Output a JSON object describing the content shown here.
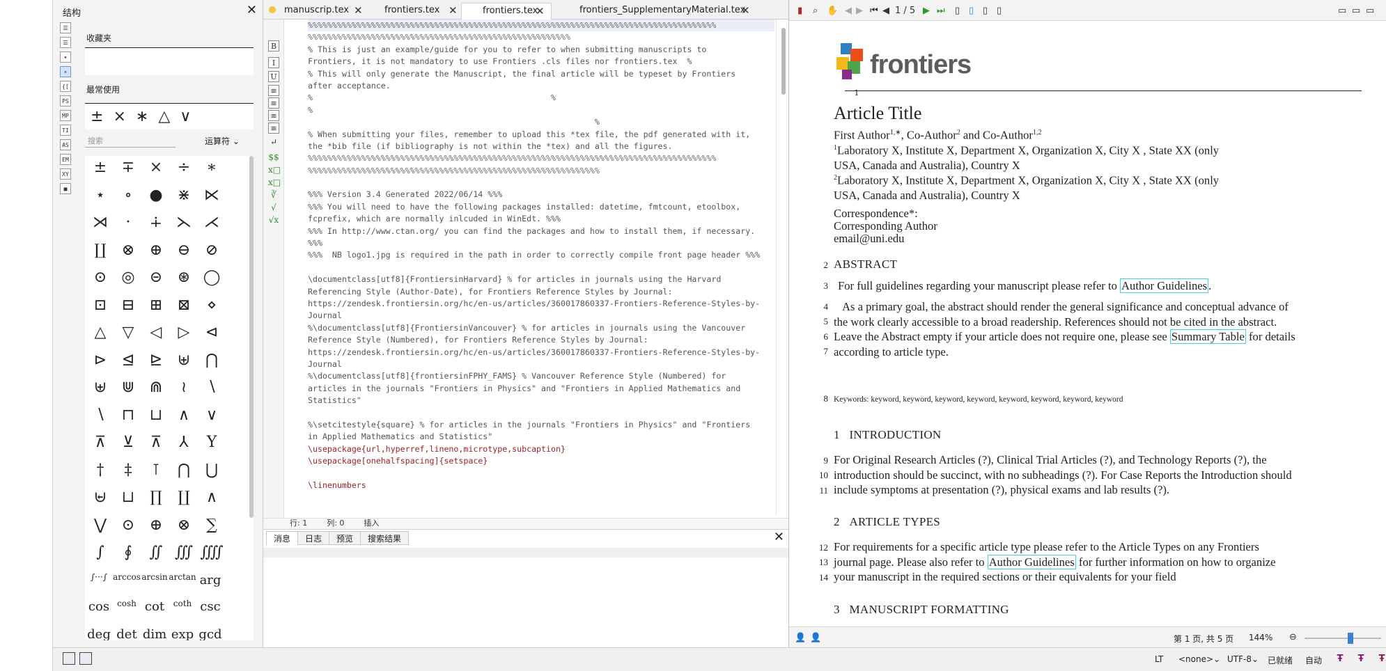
{
  "structure": {
    "title": "结构",
    "favorites_label": "收藏夹",
    "recent_label": "最常使用",
    "recent_symbols": [
      "±",
      "×",
      "∗",
      "△",
      "∨"
    ],
    "search_placeholder": "搜索",
    "category": "运算符",
    "vtools": [
      "☰",
      "☰",
      "▾",
      "∗",
      "{[",
      "PS",
      "MP",
      "TI",
      "AS",
      "EM",
      "XY",
      "■"
    ],
    "symbols": [
      [
        "±",
        "∓",
        "×",
        "÷",
        "∗"
      ],
      [
        "⋆",
        "∘",
        "●",
        "⋇",
        "⋉"
      ],
      [
        "⋊",
        "·",
        "∔",
        "⋋",
        "⋌"
      ],
      [
        "∐",
        "⊗",
        "⊕",
        "⊖",
        "⊘"
      ],
      [
        "⊙",
        "◎",
        "⊝",
        "⊛",
        "◯"
      ],
      [
        "⊡",
        "⊟",
        "⊞",
        "⊠",
        "⋄"
      ],
      [
        "△",
        "▽",
        "◁",
        "▷",
        "⊲"
      ],
      [
        "⊳",
        "⊴",
        "⊵",
        "⊎",
        "⋂"
      ],
      [
        "⊎",
        "⋓",
        "⋒",
        "≀",
        "∖"
      ],
      [
        "∖",
        "⊓",
        "⊔",
        "∧",
        "∨"
      ],
      [
        "⊼",
        "⊻",
        "⊼",
        "⅄",
        "Y"
      ],
      [
        "†",
        "‡",
        "⊺",
        "⋂",
        "⋃"
      ],
      [
        "⊌",
        "⊔",
        "∏",
        "∐",
        "∧"
      ],
      [
        "⋁",
        "⊙",
        "⊕",
        "⊗",
        "∑"
      ],
      [
        "∫",
        "∮",
        "∬",
        "∭",
        "⨌"
      ]
    ],
    "functions_small": [
      "∫···∫",
      "arccos",
      "arcsin",
      "arctan"
    ],
    "functions_big": [
      "arg"
    ],
    "functions_row2": [
      "cos",
      "cosh",
      "cot",
      "coth",
      "csc"
    ],
    "functions_row3": [
      "deg",
      "det",
      "dim",
      "exp",
      "gcd"
    ]
  },
  "editor": {
    "tabs": [
      {
        "label": "manuscrip.tex"
      },
      {
        "label": "frontiers.tex"
      },
      {
        "label": "frontiers.tex"
      },
      {
        "label": "frontiers_SupplementaryMaterial.tex"
      }
    ],
    "tools": [
      "B",
      "I",
      "U",
      "≡",
      "≡",
      "≡",
      "≡",
      "↵",
      "$$",
      "x□",
      "x□",
      "∛",
      "√",
      "√x"
    ],
    "code_lines": [
      {
        "t": "%%%%%%%%%%%%%%%%%%%%%%%%%%%%%%%%%%%%%%%%%%%%%%%%%%%%%%%%%%%%%%%%%%%%%%%%%%%%%%%%%%%%",
        "k": "pct hl"
      },
      {
        "t": "%%%%%%%%%%%%%%%%%%%%%%%%%%%%%%%%%%%%%%%%%%%%%%%%%%%%%%",
        "k": "pct"
      },
      {
        "t": "% This is just an example/guide for you to refer to when submitting manuscripts to",
        "k": "comment"
      },
      {
        "t": "Frontiers, it is not mandatory to use Frontiers .cls files nor frontiers.tex  %",
        "k": "comment"
      },
      {
        "t": "% This will only generate the Manuscript, the final article will be typeset by Frontiers",
        "k": "comment"
      },
      {
        "t": "after acceptance.",
        "k": "comment"
      },
      {
        "t": "%                                                 %",
        "k": "comment"
      },
      {
        "t": "%",
        "k": "comment"
      },
      {
        "t": "                                                           %",
        "k": "comment"
      },
      {
        "t": "% When submitting your files, remember to upload this *tex file, the pdf generated with it,",
        "k": "comment"
      },
      {
        "t": "the *bib file (if bibliography is not within the *tex) and all the figures.",
        "k": "comment"
      },
      {
        "t": "%%%%%%%%%%%%%%%%%%%%%%%%%%%%%%%%%%%%%%%%%%%%%%%%%%%%%%%%%%%%%%%%%%%%%%%%%%%%%%%%%%%%",
        "k": "pct"
      },
      {
        "t": "%%%%%%%%%%%%%%%%%%%%%%%%%%%%%%%%%%%%%%%%%%%%%%%%%%%%%%%%%%%%",
        "k": "pct"
      },
      {
        "t": "",
        "k": "comment"
      },
      {
        "t": "%%% Version 3.4 Generated 2022/06/14 %%%",
        "k": "comment"
      },
      {
        "t": "%%% You will need to have the following packages installed: datetime, fmtcount, etoolbox,",
        "k": "comment"
      },
      {
        "t": "fcprefix, which are normally inlcuded in WinEdt. %%%",
        "k": "comment"
      },
      {
        "t": "%%% In http://www.ctan.org/ you can find the packages and how to install them, if necessary.",
        "k": "comment"
      },
      {
        "t": "%%%",
        "k": "comment"
      },
      {
        "t": "%%%  NB logo1.jpg is required in the path in order to correctly compile front page header %%%",
        "k": "comment"
      },
      {
        "t": "",
        "k": "comment"
      },
      {
        "t": "\\documentclass[utf8]{FrontiersinHarvard} % for articles in journals using the Harvard",
        "k": "comment"
      },
      {
        "t": "Referencing Style (Author-Date), for Frontiers Reference Styles by Journal:",
        "k": "comment"
      },
      {
        "t": "https://zendesk.frontiersin.org/hc/en-us/articles/360017860337-Frontiers-Reference-Styles-by-",
        "k": "comment"
      },
      {
        "t": "Journal",
        "k": "comment"
      },
      {
        "t": "%\\documentclass[utf8]{FrontiersinVancouver} % for articles in journals using the Vancouver",
        "k": "comment"
      },
      {
        "t": "Reference Style (Numbered), for Frontiers Reference Styles by Journal:",
        "k": "comment"
      },
      {
        "t": "https://zendesk.frontiersin.org/hc/en-us/articles/360017860337-Frontiers-Reference-Styles-by-",
        "k": "comment"
      },
      {
        "t": "Journal",
        "k": "comment"
      },
      {
        "t": "%\\documentclass[utf8]{frontiersinFPHY_FAMS} % Vancouver Reference Style (Numbered) for",
        "k": "comment"
      },
      {
        "t": "articles in the journals \"Frontiers in Physics\" and \"Frontiers in Applied Mathematics and",
        "k": "comment"
      },
      {
        "t": "Statistics\"",
        "k": "comment"
      },
      {
        "t": "",
        "k": "comment"
      },
      {
        "t": "%\\setcitestyle{square} % for articles in the journals \"Frontiers in Physics\" and \"Frontiers",
        "k": "comment"
      },
      {
        "t": "in Applied Mathematics and Statistics\"",
        "k": "comment"
      },
      {
        "t": "\\usepackage{url,hyperref,lineno,microtype,subcaption}",
        "k": "cmd"
      },
      {
        "t": "\\usepackage[onehalfspacing]{setspace}",
        "k": "cmd"
      },
      {
        "t": "",
        "k": "comment"
      },
      {
        "t": "\\linenumbers",
        "k": "cmd"
      }
    ],
    "status": {
      "row_label": "行: 1",
      "col_label": "列: 0",
      "mode": "插入"
    }
  },
  "messages": {
    "tabs": [
      "消息",
      "日志",
      "预览",
      "搜索结果"
    ]
  },
  "pdf": {
    "page_indicator": "1 / 5",
    "logo_text": "frontiers",
    "title": "Article Title",
    "authors": {
      "a1": "First Author",
      "a1_sup": "1,∗",
      "a2": ", Co-Author",
      "a2_sup": "2",
      "a3": " and Co-Author",
      "a3_sup": "1,2"
    },
    "affil1_sup": "1",
    "affil1_l1": "Laboratory X, Institute X, Department X, Organization X, City X , State XX (only",
    "affil1_l2": "USA, Canada and Australia), Country X",
    "affil2_sup": "2",
    "affil2_l1": "Laboratory X, Institute X, Department X, Organization X, City X , State XX (only",
    "affil2_l2": "USA, Canada and Australia), Country X",
    "corr_label": "Correspondence*:",
    "corr_name": "Corresponding Author",
    "corr_email": "email@uni.edu",
    "abstract_head": "ABSTRACT",
    "abs_p1_a": "For full guidelines regarding your manuscript please refer to ",
    "abs_p1_link": "Author Guidelines",
    "abs_p1_b": ".",
    "abs_l1": "As a primary goal, the abstract should render the general significance and conceptual advance of",
    "abs_l2": "the work clearly accessible to a broad readership. References should not be cited in the abstract.",
    "abs_l3_a": "Leave the Abstract empty if your article does not require one, please see ",
    "abs_l3_link": "Summary Table",
    "abs_l3_b": " for details",
    "abs_l4": "according to article type.",
    "keywords": "Keywords: keyword, keyword, keyword, keyword, keyword, keyword, keyword, keyword",
    "sec1_num": "1",
    "sec1": "INTRODUCTION",
    "intro_l1": "For Original Research Articles (?), Clinical Trial Articles (?), and Technology Reports (?), the",
    "intro_l2": "introduction should be succinct, with no subheadings (?). For Case Reports the Introduction should",
    "intro_l3": "include symptoms at presentation (?), physical exams and lab results (?).",
    "sec2_num": "2",
    "sec2": "ARTICLE TYPES",
    "at_l1": "For requirements for a specific article type please refer to the Article Types on any Frontiers",
    "at_l2_a": "journal page. Please also refer to ",
    "at_l2_link": "Author Guidelines",
    "at_l2_b": " for further information on how to organize",
    "at_l3": "your manuscript in the required sections or their equivalents for your field",
    "sec3_num": "3",
    "sec3": "MANUSCRIPT FORMATTING",
    "line_numbers": [
      "1",
      "2",
      "3",
      "4",
      "5",
      "6",
      "7",
      "8",
      "9",
      "10",
      "11",
      "12",
      "13",
      "14"
    ],
    "page_info": "第 1 页, 共 5 页",
    "zoom": "144%"
  },
  "statusbar": {
    "encoding_mode": "<none>",
    "encoding": "UTF-8",
    "ready": "已就绪",
    "auto": "自动"
  }
}
